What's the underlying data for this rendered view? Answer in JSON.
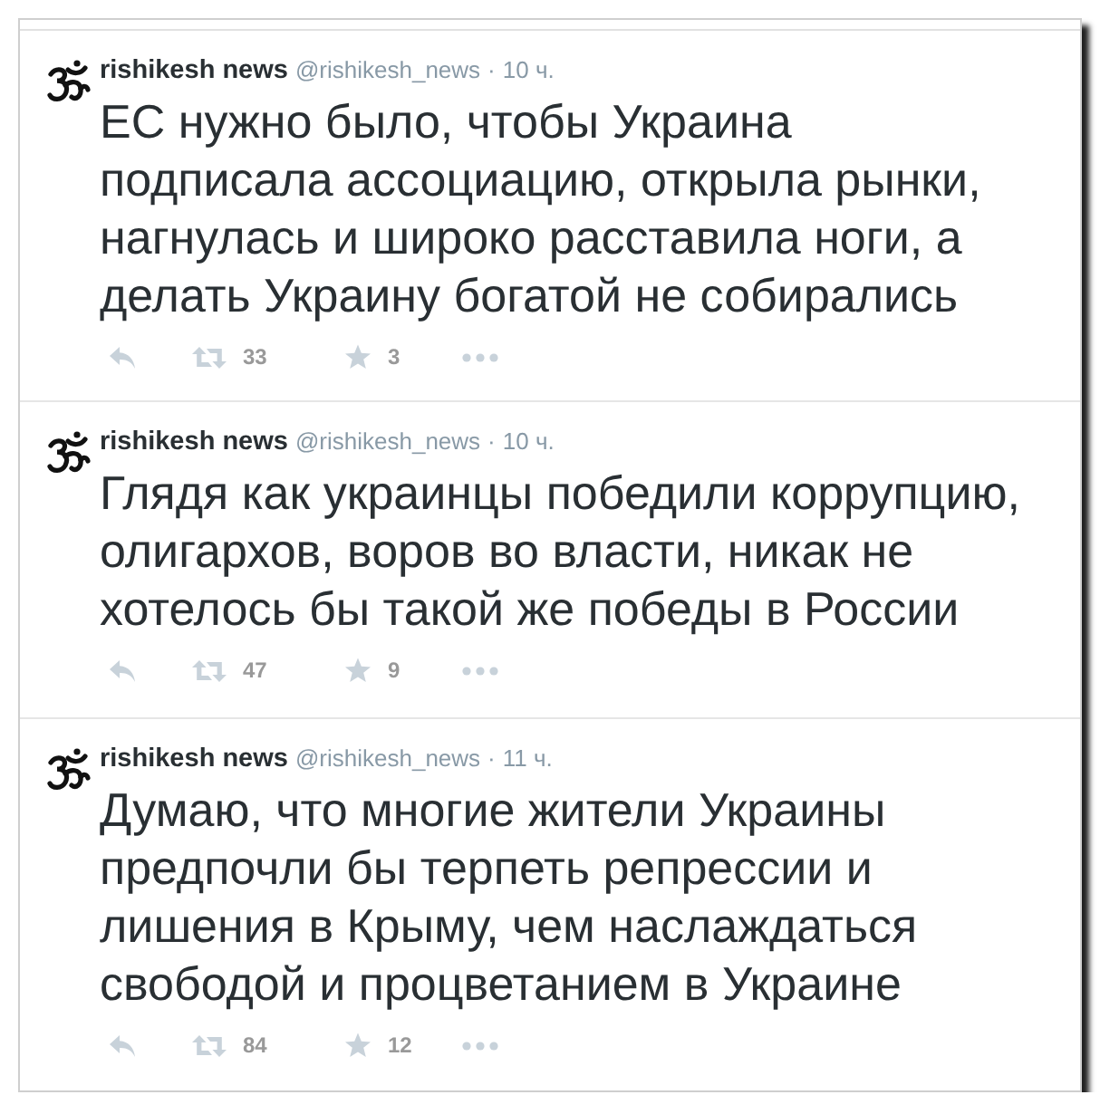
{
  "tweets": [
    {
      "name": "rishikesh news",
      "handle": "@rishikesh_news",
      "separator": "·",
      "time": "10 ч.",
      "text": "ЕС нужно было, чтобы Украина подписала ассоциацию, открыла рынки, нагнулась и широко расставила ноги, а делать Украину богатой не собирались",
      "retweets": "33",
      "favorites": "3"
    },
    {
      "name": "rishikesh news",
      "handle": "@rishikesh_news",
      "separator": "·",
      "time": "10 ч.",
      "text": "Глядя как украинцы победили коррупцию, олигархов, воров во власти, никак не хотелось бы такой же победы в России",
      "retweets": "47",
      "favorites": "9"
    },
    {
      "name": "rishikesh news",
      "handle": "@rishikesh_news",
      "separator": "·",
      "time": "11 ч.",
      "text": "Думаю, что многие жители Украины предпочли бы терпеть репрессии и лишения в Крыму, чем наслаждаться свободой и процветанием в Украине",
      "retweets": "84",
      "favorites": "12"
    }
  ]
}
